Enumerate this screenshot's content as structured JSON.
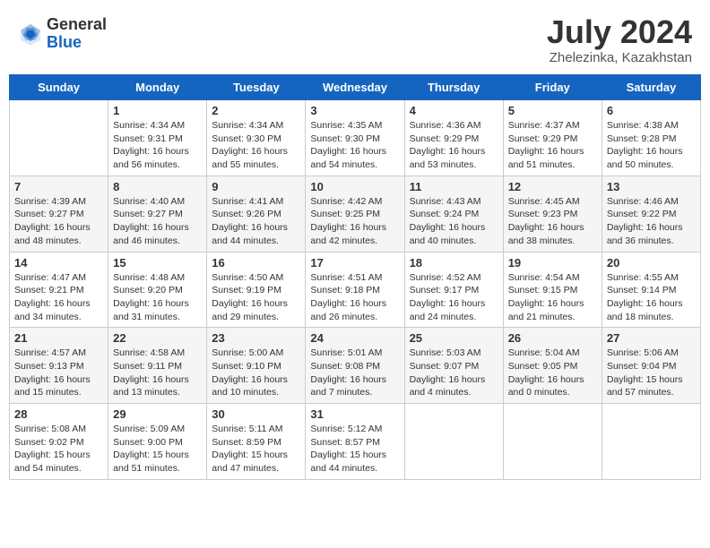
{
  "header": {
    "logo_general": "General",
    "logo_blue": "Blue",
    "month_year": "July 2024",
    "location": "Zhelezinka, Kazakhstan"
  },
  "calendar": {
    "days_of_week": [
      "Sunday",
      "Monday",
      "Tuesday",
      "Wednesday",
      "Thursday",
      "Friday",
      "Saturday"
    ],
    "weeks": [
      [
        {
          "day": "",
          "sunrise": "",
          "sunset": "",
          "daylight": ""
        },
        {
          "day": "1",
          "sunrise": "Sunrise: 4:34 AM",
          "sunset": "Sunset: 9:31 PM",
          "daylight": "Daylight: 16 hours and 56 minutes."
        },
        {
          "day": "2",
          "sunrise": "Sunrise: 4:34 AM",
          "sunset": "Sunset: 9:30 PM",
          "daylight": "Daylight: 16 hours and 55 minutes."
        },
        {
          "day": "3",
          "sunrise": "Sunrise: 4:35 AM",
          "sunset": "Sunset: 9:30 PM",
          "daylight": "Daylight: 16 hours and 54 minutes."
        },
        {
          "day": "4",
          "sunrise": "Sunrise: 4:36 AM",
          "sunset": "Sunset: 9:29 PM",
          "daylight": "Daylight: 16 hours and 53 minutes."
        },
        {
          "day": "5",
          "sunrise": "Sunrise: 4:37 AM",
          "sunset": "Sunset: 9:29 PM",
          "daylight": "Daylight: 16 hours and 51 minutes."
        },
        {
          "day": "6",
          "sunrise": "Sunrise: 4:38 AM",
          "sunset": "Sunset: 9:28 PM",
          "daylight": "Daylight: 16 hours and 50 minutes."
        }
      ],
      [
        {
          "day": "7",
          "sunrise": "Sunrise: 4:39 AM",
          "sunset": "Sunset: 9:27 PM",
          "daylight": "Daylight: 16 hours and 48 minutes."
        },
        {
          "day": "8",
          "sunrise": "Sunrise: 4:40 AM",
          "sunset": "Sunset: 9:27 PM",
          "daylight": "Daylight: 16 hours and 46 minutes."
        },
        {
          "day": "9",
          "sunrise": "Sunrise: 4:41 AM",
          "sunset": "Sunset: 9:26 PM",
          "daylight": "Daylight: 16 hours and 44 minutes."
        },
        {
          "day": "10",
          "sunrise": "Sunrise: 4:42 AM",
          "sunset": "Sunset: 9:25 PM",
          "daylight": "Daylight: 16 hours and 42 minutes."
        },
        {
          "day": "11",
          "sunrise": "Sunrise: 4:43 AM",
          "sunset": "Sunset: 9:24 PM",
          "daylight": "Daylight: 16 hours and 40 minutes."
        },
        {
          "day": "12",
          "sunrise": "Sunrise: 4:45 AM",
          "sunset": "Sunset: 9:23 PM",
          "daylight": "Daylight: 16 hours and 38 minutes."
        },
        {
          "day": "13",
          "sunrise": "Sunrise: 4:46 AM",
          "sunset": "Sunset: 9:22 PM",
          "daylight": "Daylight: 16 hours and 36 minutes."
        }
      ],
      [
        {
          "day": "14",
          "sunrise": "Sunrise: 4:47 AM",
          "sunset": "Sunset: 9:21 PM",
          "daylight": "Daylight: 16 hours and 34 minutes."
        },
        {
          "day": "15",
          "sunrise": "Sunrise: 4:48 AM",
          "sunset": "Sunset: 9:20 PM",
          "daylight": "Daylight: 16 hours and 31 minutes."
        },
        {
          "day": "16",
          "sunrise": "Sunrise: 4:50 AM",
          "sunset": "Sunset: 9:19 PM",
          "daylight": "Daylight: 16 hours and 29 minutes."
        },
        {
          "day": "17",
          "sunrise": "Sunrise: 4:51 AM",
          "sunset": "Sunset: 9:18 PM",
          "daylight": "Daylight: 16 hours and 26 minutes."
        },
        {
          "day": "18",
          "sunrise": "Sunrise: 4:52 AM",
          "sunset": "Sunset: 9:17 PM",
          "daylight": "Daylight: 16 hours and 24 minutes."
        },
        {
          "day": "19",
          "sunrise": "Sunrise: 4:54 AM",
          "sunset": "Sunset: 9:15 PM",
          "daylight": "Daylight: 16 hours and 21 minutes."
        },
        {
          "day": "20",
          "sunrise": "Sunrise: 4:55 AM",
          "sunset": "Sunset: 9:14 PM",
          "daylight": "Daylight: 16 hours and 18 minutes."
        }
      ],
      [
        {
          "day": "21",
          "sunrise": "Sunrise: 4:57 AM",
          "sunset": "Sunset: 9:13 PM",
          "daylight": "Daylight: 16 hours and 15 minutes."
        },
        {
          "day": "22",
          "sunrise": "Sunrise: 4:58 AM",
          "sunset": "Sunset: 9:11 PM",
          "daylight": "Daylight: 16 hours and 13 minutes."
        },
        {
          "day": "23",
          "sunrise": "Sunrise: 5:00 AM",
          "sunset": "Sunset: 9:10 PM",
          "daylight": "Daylight: 16 hours and 10 minutes."
        },
        {
          "day": "24",
          "sunrise": "Sunrise: 5:01 AM",
          "sunset": "Sunset: 9:08 PM",
          "daylight": "Daylight: 16 hours and 7 minutes."
        },
        {
          "day": "25",
          "sunrise": "Sunrise: 5:03 AM",
          "sunset": "Sunset: 9:07 PM",
          "daylight": "Daylight: 16 hours and 4 minutes."
        },
        {
          "day": "26",
          "sunrise": "Sunrise: 5:04 AM",
          "sunset": "Sunset: 9:05 PM",
          "daylight": "Daylight: 16 hours and 0 minutes."
        },
        {
          "day": "27",
          "sunrise": "Sunrise: 5:06 AM",
          "sunset": "Sunset: 9:04 PM",
          "daylight": "Daylight: 15 hours and 57 minutes."
        }
      ],
      [
        {
          "day": "28",
          "sunrise": "Sunrise: 5:08 AM",
          "sunset": "Sunset: 9:02 PM",
          "daylight": "Daylight: 15 hours and 54 minutes."
        },
        {
          "day": "29",
          "sunrise": "Sunrise: 5:09 AM",
          "sunset": "Sunset: 9:00 PM",
          "daylight": "Daylight: 15 hours and 51 minutes."
        },
        {
          "day": "30",
          "sunrise": "Sunrise: 5:11 AM",
          "sunset": "Sunset: 8:59 PM",
          "daylight": "Daylight: 15 hours and 47 minutes."
        },
        {
          "day": "31",
          "sunrise": "Sunrise: 5:12 AM",
          "sunset": "Sunset: 8:57 PM",
          "daylight": "Daylight: 15 hours and 44 minutes."
        },
        {
          "day": "",
          "sunrise": "",
          "sunset": "",
          "daylight": ""
        },
        {
          "day": "",
          "sunrise": "",
          "sunset": "",
          "daylight": ""
        },
        {
          "day": "",
          "sunrise": "",
          "sunset": "",
          "daylight": ""
        }
      ]
    ]
  }
}
